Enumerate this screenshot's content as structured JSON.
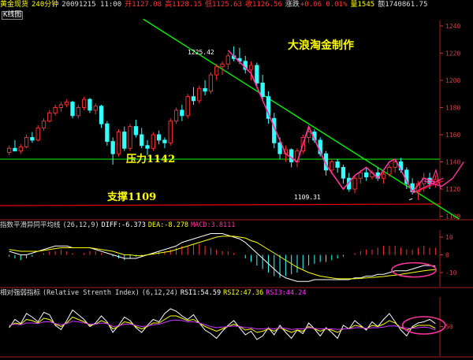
{
  "header": {
    "instrument": "黄金现货",
    "period": "240分钟",
    "date_time": "20091215 11:00",
    "open": "开1127.08",
    "high": "高1128.15",
    "low": "低1125.63",
    "close": "收1126.56",
    "change_label": "涨跌",
    "change": "+0.06 0.01%",
    "volume": "量1545",
    "amount": "额1740861.75"
  },
  "tab_label": "K线图",
  "watermark": "大浪淘金制作",
  "resistance_label": "压力1142",
  "support_label": "支撑1109",
  "high_marker": "1225.42",
  "low_marker": "1109.31",
  "macd_header": {
    "name": "指数平滑异同平均线",
    "params": "(26,12,9)",
    "diff": "DIFF:-6.373",
    "dea": "DEA:-8.278",
    "macd": "MACD:3.8111"
  },
  "rsi_header": {
    "name": "相对强弱指标",
    "full_name": "(Relative Strenth Index)",
    "params": "(6,12,24)",
    "rsi1": "RSI1:54.59",
    "rsi2": "RSI2:47.36",
    "rsi3": "RSI3:44.24"
  },
  "colors": {
    "background": "#000000",
    "up": "#ff3333",
    "down": "#33ffff",
    "trend": "#00ee00",
    "resist": "#00dd00",
    "support": "#ee0000",
    "magenta": "#ff3399",
    "yellow": "#ffff00",
    "white": "#ffffff",
    "purple": "#cc33ff"
  },
  "chart_data": [
    {
      "type": "candlestick",
      "title": "黄金现货 240分钟",
      "ylim": [
        1098,
        1244
      ],
      "y_ticks": [
        1240,
        1220,
        1200,
        1180,
        1160,
        1140,
        1120,
        1100
      ],
      "candles": [
        [
          1147,
          1152,
          1145,
          1150
        ],
        [
          1150,
          1156,
          1149,
          1148
        ],
        [
          1148,
          1153,
          1146,
          1151
        ],
        [
          1151,
          1160,
          1150,
          1158
        ],
        [
          1158,
          1162,
          1154,
          1156
        ],
        [
          1156,
          1167,
          1155,
          1165
        ],
        [
          1165,
          1172,
          1163,
          1170
        ],
        [
          1170,
          1178,
          1169,
          1176
        ],
        [
          1176,
          1182,
          1174,
          1180
        ],
        [
          1180,
          1184,
          1177,
          1182
        ],
        [
          1182,
          1186,
          1180,
          1184
        ],
        [
          1184,
          1185,
          1172,
          1174
        ],
        [
          1174,
          1182,
          1172,
          1180
        ],
        [
          1180,
          1188,
          1178,
          1186
        ],
        [
          1186,
          1187,
          1176,
          1178
        ],
        [
          1178,
          1183,
          1175,
          1181
        ],
        [
          1181,
          1182,
          1165,
          1168
        ],
        [
          1168,
          1170,
          1152,
          1155
        ],
        [
          1155,
          1158,
          1138,
          1146
        ],
        [
          1146,
          1164,
          1144,
          1162
        ],
        [
          1162,
          1166,
          1148,
          1150
        ],
        [
          1150,
          1168,
          1148,
          1166
        ],
        [
          1166,
          1171,
          1158,
          1160
        ],
        [
          1160,
          1165,
          1150,
          1152
        ],
        [
          1152,
          1156,
          1145,
          1150
        ],
        [
          1150,
          1162,
          1148,
          1160
        ],
        [
          1160,
          1163,
          1153,
          1156
        ],
        [
          1156,
          1158,
          1150,
          1154
        ],
        [
          1154,
          1172,
          1152,
          1170
        ],
        [
          1170,
          1180,
          1168,
          1178
        ],
        [
          1178,
          1182,
          1170,
          1174
        ],
        [
          1174,
          1190,
          1172,
          1188
        ],
        [
          1188,
          1195,
          1182,
          1185
        ],
        [
          1185,
          1196,
          1183,
          1194
        ],
        [
          1194,
          1200,
          1189,
          1192
        ],
        [
          1192,
          1206,
          1190,
          1204
        ],
        [
          1204,
          1212,
          1200,
          1210
        ],
        [
          1210,
          1214,
          1204,
          1212
        ],
        [
          1212,
          1220,
          1208,
          1218
        ],
        [
          1218,
          1225,
          1214,
          1216
        ],
        [
          1216,
          1224,
          1212,
          1214
        ],
        [
          1214,
          1218,
          1205,
          1208
        ],
        [
          1208,
          1214,
          1200,
          1211
        ],
        [
          1211,
          1213,
          1196,
          1198
        ],
        [
          1198,
          1204,
          1185,
          1188
        ],
        [
          1188,
          1192,
          1168,
          1172
        ],
        [
          1172,
          1176,
          1150,
          1154
        ],
        [
          1154,
          1158,
          1142,
          1146
        ],
        [
          1146,
          1152,
          1140,
          1149
        ],
        [
          1149,
          1150,
          1136,
          1140
        ],
        [
          1140,
          1150,
          1136,
          1148
        ],
        [
          1148,
          1160,
          1146,
          1158
        ],
        [
          1158,
          1166,
          1154,
          1162
        ],
        [
          1162,
          1164,
          1154,
          1156
        ],
        [
          1156,
          1158,
          1144,
          1146
        ],
        [
          1146,
          1148,
          1130,
          1134
        ],
        [
          1134,
          1142,
          1131,
          1140
        ],
        [
          1140,
          1142,
          1132,
          1136
        ],
        [
          1136,
          1138,
          1124,
          1128
        ],
        [
          1128,
          1132,
          1118,
          1120
        ],
        [
          1120,
          1130,
          1117,
          1128
        ],
        [
          1128,
          1134,
          1124,
          1132
        ],
        [
          1132,
          1136,
          1126,
          1129
        ],
        [
          1129,
          1134,
          1127,
          1132
        ],
        [
          1132,
          1136,
          1126,
          1128
        ],
        [
          1128,
          1133,
          1124,
          1131
        ],
        [
          1131,
          1138,
          1129,
          1136
        ],
        [
          1136,
          1142,
          1132,
          1140
        ],
        [
          1140,
          1143,
          1132,
          1134
        ],
        [
          1134,
          1136,
          1120,
          1124
        ],
        [
          1124,
          1128,
          1116,
          1118
        ],
        [
          1118,
          1126,
          1112,
          1124
        ],
        [
          1124,
          1132,
          1118,
          1128
        ],
        [
          1128,
          1132,
          1120,
          1124
        ],
        [
          1124,
          1130,
          1121,
          1127
        ]
      ],
      "resistance": 1142,
      "support": 1109,
      "high_marker": 1225.42,
      "low_marker": 1109.31
    },
    {
      "type": "bar",
      "title": "指数平滑异同平均线 (26,12,9)",
      "ylim": [
        -18,
        14
      ],
      "y_ticks": [
        10,
        0,
        -10
      ],
      "macd_hist": [
        -1,
        -2,
        -3,
        -2,
        -1,
        0,
        1,
        2,
        2,
        3,
        2,
        1,
        0,
        1,
        2,
        2,
        1,
        0,
        -1,
        -2,
        -3,
        -2,
        -1,
        -1,
        0,
        1,
        2,
        2,
        3,
        4,
        5,
        5,
        6,
        6,
        5,
        4,
        3,
        2,
        2,
        1,
        0,
        -2,
        -4,
        -6,
        -8,
        -10,
        -12,
        -13,
        -12,
        -11,
        -10,
        -8,
        -6,
        -5,
        -4,
        -4,
        -3,
        -2,
        -1,
        0,
        1,
        2,
        3,
        3,
        4,
        5,
        5,
        5,
        4,
        3,
        3,
        4,
        5,
        4,
        4
      ],
      "diff": [
        2,
        1,
        0,
        0,
        1,
        2,
        3,
        4,
        5,
        5,
        5,
        4,
        4,
        4,
        4,
        3,
        2,
        1,
        0,
        -1,
        -2,
        -2,
        -2,
        -1,
        0,
        1,
        2,
        3,
        4,
        5,
        7,
        8,
        9,
        10,
        11,
        12,
        12,
        12,
        11,
        10,
        9,
        7,
        4,
        1,
        -2,
        -5,
        -8,
        -11,
        -13,
        -14,
        -15,
        -15,
        -15,
        -14,
        -14,
        -14,
        -14,
        -14,
        -14,
        -14,
        -13,
        -13,
        -12,
        -12,
        -11,
        -11,
        -10,
        -9,
        -9,
        -9,
        -8,
        -7,
        -6,
        -6,
        -6.4
      ],
      "dea": [
        3,
        2.5,
        2,
        2,
        2,
        2,
        2.5,
        3,
        3.5,
        4,
        4,
        4,
        4,
        4,
        4,
        3.5,
        3,
        2.5,
        2,
        1,
        0,
        0,
        -0.5,
        -0.5,
        0,
        0.5,
        1,
        1.5,
        2,
        3,
        4,
        5,
        6,
        7,
        8,
        9,
        10,
        10.5,
        10.5,
        10.5,
        10,
        9.5,
        8,
        7,
        5,
        3,
        1,
        -1,
        -3,
        -5,
        -7,
        -8.5,
        -10,
        -11,
        -12,
        -12.5,
        -13,
        -13.5,
        -13.5,
        -13.5,
        -13.5,
        -13.3,
        -13,
        -12.8,
        -12.5,
        -12.2,
        -11.8,
        -11.5,
        -11,
        -10.5,
        -10,
        -9.5,
        -9,
        -8.6,
        -8.3
      ]
    },
    {
      "type": "line",
      "title": "相对强弱指标 (6,12,24)",
      "ylim": [
        0,
        100
      ],
      "y_ticks": [
        50
      ],
      "series": [
        {
          "name": "RSI1",
          "values": [
            48,
            62,
            55,
            72,
            66,
            58,
            74,
            70,
            52,
            45,
            60,
            78,
            70,
            62,
            50,
            56,
            68,
            58,
            40,
            52,
            66,
            60,
            48,
            40,
            52,
            62,
            58,
            72,
            80,
            76,
            68,
            62,
            70,
            56,
            44,
            38,
            30,
            42,
            52,
            60,
            48,
            36,
            42,
            28,
            34,
            48,
            36,
            52,
            40,
            30,
            44,
            38,
            56,
            46,
            34,
            48,
            40,
            30,
            52,
            46,
            60,
            52,
            44,
            58,
            50,
            62,
            72,
            58,
            44,
            34,
            50,
            56,
            58,
            62,
            55
          ]
        },
        {
          "name": "RSI2",
          "values": [
            50,
            56,
            54,
            62,
            60,
            56,
            64,
            62,
            54,
            50,
            56,
            66,
            62,
            58,
            52,
            54,
            60,
            56,
            46,
            50,
            58,
            56,
            50,
            46,
            50,
            56,
            56,
            62,
            68,
            68,
            64,
            60,
            62,
            56,
            50,
            46,
            42,
            46,
            50,
            54,
            50,
            44,
            46,
            40,
            42,
            46,
            42,
            48,
            44,
            40,
            44,
            42,
            50,
            46,
            42,
            46,
            44,
            40,
            46,
            46,
            52,
            50,
            46,
            52,
            50,
            54,
            60,
            56,
            48,
            44,
            48,
            52,
            52,
            52,
            47
          ]
        },
        {
          "name": "RSI3",
          "values": [
            52,
            54,
            53,
            56,
            56,
            55,
            58,
            58,
            55,
            53,
            55,
            59,
            58,
            56,
            54,
            54,
            56,
            55,
            50,
            51,
            54,
            54,
            52,
            50,
            51,
            53,
            54,
            57,
            60,
            61,
            60,
            58,
            58,
            56,
            53,
            50,
            48,
            49,
            50,
            51,
            50,
            48,
            48,
            46,
            46,
            47,
            46,
            48,
            47,
            45,
            46,
            46,
            48,
            47,
            46,
            46,
            46,
            45,
            46,
            46,
            48,
            48,
            47,
            48,
            48,
            49,
            51,
            51,
            49,
            47,
            47,
            48,
            49,
            48,
            44
          ]
        }
      ]
    }
  ]
}
